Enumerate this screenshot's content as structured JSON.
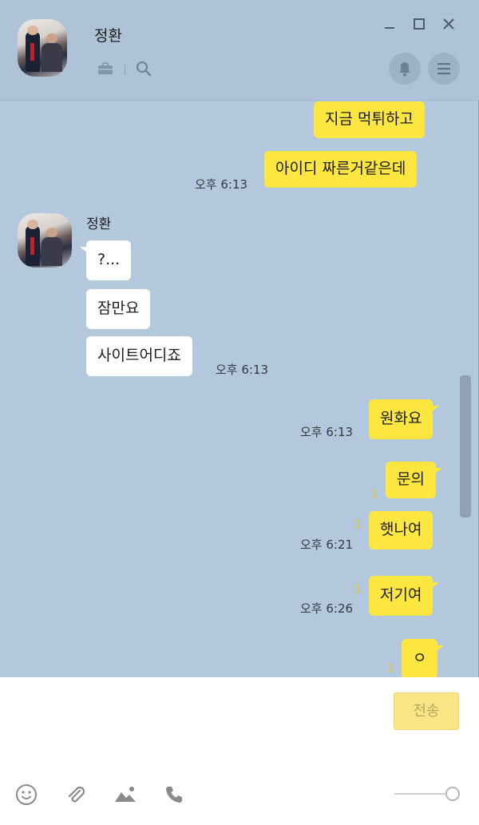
{
  "header": {
    "contact_name": "정환",
    "icons": [
      "briefcase-icon",
      "search-icon",
      "bell-icon",
      "menu-icon",
      "minimize-icon",
      "maximize-icon",
      "close-icon"
    ]
  },
  "messages": [
    {
      "side": "me",
      "text": "지금 먹튀하고"
    },
    {
      "side": "me",
      "text": "아이디 짜른거같은데",
      "time": "오후 6:13"
    },
    {
      "sender": "정환"
    },
    {
      "side": "them",
      "text": "?..."
    },
    {
      "side": "them",
      "text": "잠만요"
    },
    {
      "side": "them",
      "text": "사이트어디죠",
      "time": "오후 6:13"
    },
    {
      "side": "me",
      "text": "원화요",
      "time": "오후 6:13"
    },
    {
      "side": "me",
      "text": "문의",
      "unread": "1"
    },
    {
      "side": "me",
      "text": "햇나여",
      "unread": "1",
      "time": "오후 6:21"
    },
    {
      "side": "me",
      "text": "저기여",
      "unread": "1",
      "time": "오후 6:26"
    },
    {
      "side": "me",
      "text": "ㅇ",
      "unread": "1"
    }
  ],
  "input": {
    "send_label": "전송",
    "tools": [
      "emoji-icon",
      "attach-icon",
      "image-icon",
      "phone-icon"
    ],
    "slider_level": 1.0
  },
  "colors": {
    "background": "#b3c8dc",
    "my_bubble": "#fde640",
    "their_bubble": "#ffffff",
    "send_button": "#fbe685"
  }
}
